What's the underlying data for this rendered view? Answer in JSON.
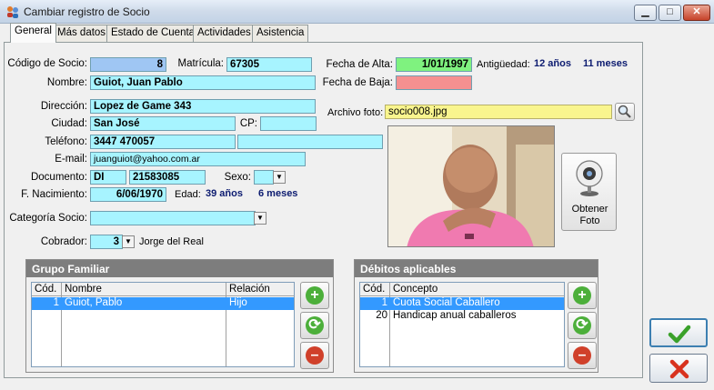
{
  "window": {
    "title": "Cambiar registro de Socio",
    "minimize": "▁",
    "maximize": "□",
    "close": "✕"
  },
  "tabs": [
    "General",
    "Más datos",
    "Estado de Cuenta",
    "Actividades",
    "Asistencia"
  ],
  "form": {
    "codigo_label": "Código de Socio:",
    "codigo": "8",
    "matricula_label": "Matrícula:",
    "matricula": "67305",
    "nombre_label": "Nombre:",
    "nombre": "Guiot, Juan Pablo",
    "direccion_label": "Dirección:",
    "direccion": "Lopez de Game 343",
    "ciudad_label": "Ciudad:",
    "ciudad": "San José",
    "cp_label": "CP:",
    "cp": "",
    "telefono_label": "Teléfono:",
    "telefono": "3447 470057",
    "telefono2": "",
    "email_label": "E-mail:",
    "email": "juanguiot@yahoo.com.ar",
    "documento_label": "Documento:",
    "doc_tipo": "DI",
    "doc_numero": "21583085",
    "sexo_label": "Sexo:",
    "sexo": "",
    "nacimiento_label": "F. Nacimiento:",
    "nacimiento": "6/06/1970",
    "edad_label": "Edad:",
    "edad_anios": "39 años",
    "edad_meses": "6 meses",
    "categoria_label": "Categoría Socio:",
    "categoria": "",
    "cobrador_label": "Cobrador:",
    "cobrador_codigo": "3",
    "cobrador_nombre": "Jorge del Real",
    "fecha_alta_label": "Fecha de Alta:",
    "fecha_alta": "1/01/1997",
    "antiguedad_label": "Antigüedad:",
    "antiguedad_anios": "12 años",
    "antiguedad_meses": "11 meses",
    "fecha_baja_label": "Fecha de Baja:",
    "fecha_baja": "",
    "archivo_label": "Archivo foto:",
    "archivo": "socio008.jpg",
    "obtener_foto_line1": "Obtener",
    "obtener_foto_line2": "Foto"
  },
  "grupo_familiar": {
    "title": "Grupo Familiar",
    "columns": [
      "Cód.",
      "Nombre",
      "Relación"
    ],
    "rows": [
      {
        "cod": "1",
        "nombre": "Guiot, Pablo",
        "relacion": "Hijo"
      }
    ]
  },
  "debitos": {
    "title": "Débitos aplicables",
    "columns": [
      "Cód.",
      "Concepto"
    ],
    "rows": [
      {
        "cod": "1",
        "concepto": "Cuota Social Caballero"
      },
      {
        "cod": "20",
        "concepto": "Handicap anual caballeros"
      }
    ]
  },
  "colors": {
    "field": "#a7f4ff",
    "alta": "#7ff27f",
    "baja": "#f59090",
    "archivo": "#f9f58e",
    "selection": "#3399ff"
  },
  "icons": {
    "add": "add-icon",
    "refresh": "refresh-icon",
    "remove": "remove-icon",
    "ok": "check-icon",
    "cancel": "cancel-icon"
  }
}
